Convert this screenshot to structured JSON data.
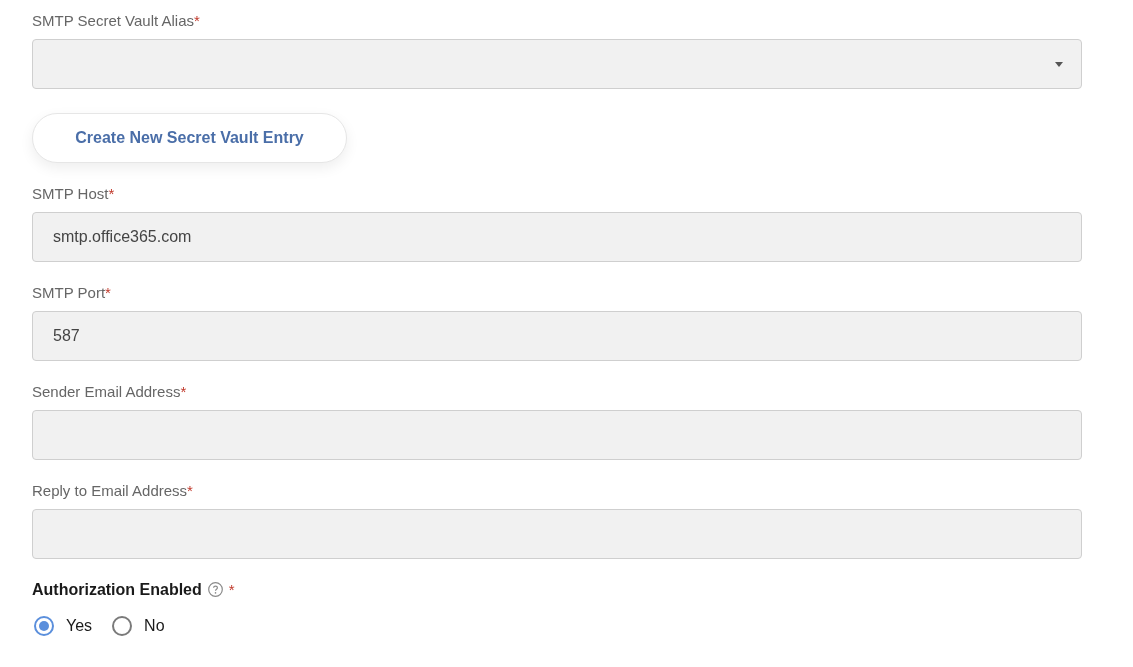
{
  "form": [
    {
      "kind": "select",
      "label": "SMTP Secret Vault Alias",
      "required_mark": "*"
    },
    {
      "kind": "button",
      "label": "Create New Secret Vault Entry"
    },
    {
      "kind": "text",
      "label": "SMTP Host",
      "required_mark": "*",
      "value": "smtp.office365.com"
    },
    {
      "kind": "text",
      "label": "SMTP Port",
      "required_mark": "*",
      "value": "587"
    },
    {
      "kind": "text",
      "label": "Sender Email Address",
      "required_mark": "*"
    },
    {
      "kind": "text",
      "label": "Reply to Email Address",
      "required_mark": "*"
    },
    {
      "kind": "radio",
      "label": "Authorization Enabled",
      "required_mark": "*",
      "options": [
        {
          "label": "Yes",
          "selected": true
        },
        {
          "label": "No",
          "selected": false
        }
      ]
    }
  ]
}
